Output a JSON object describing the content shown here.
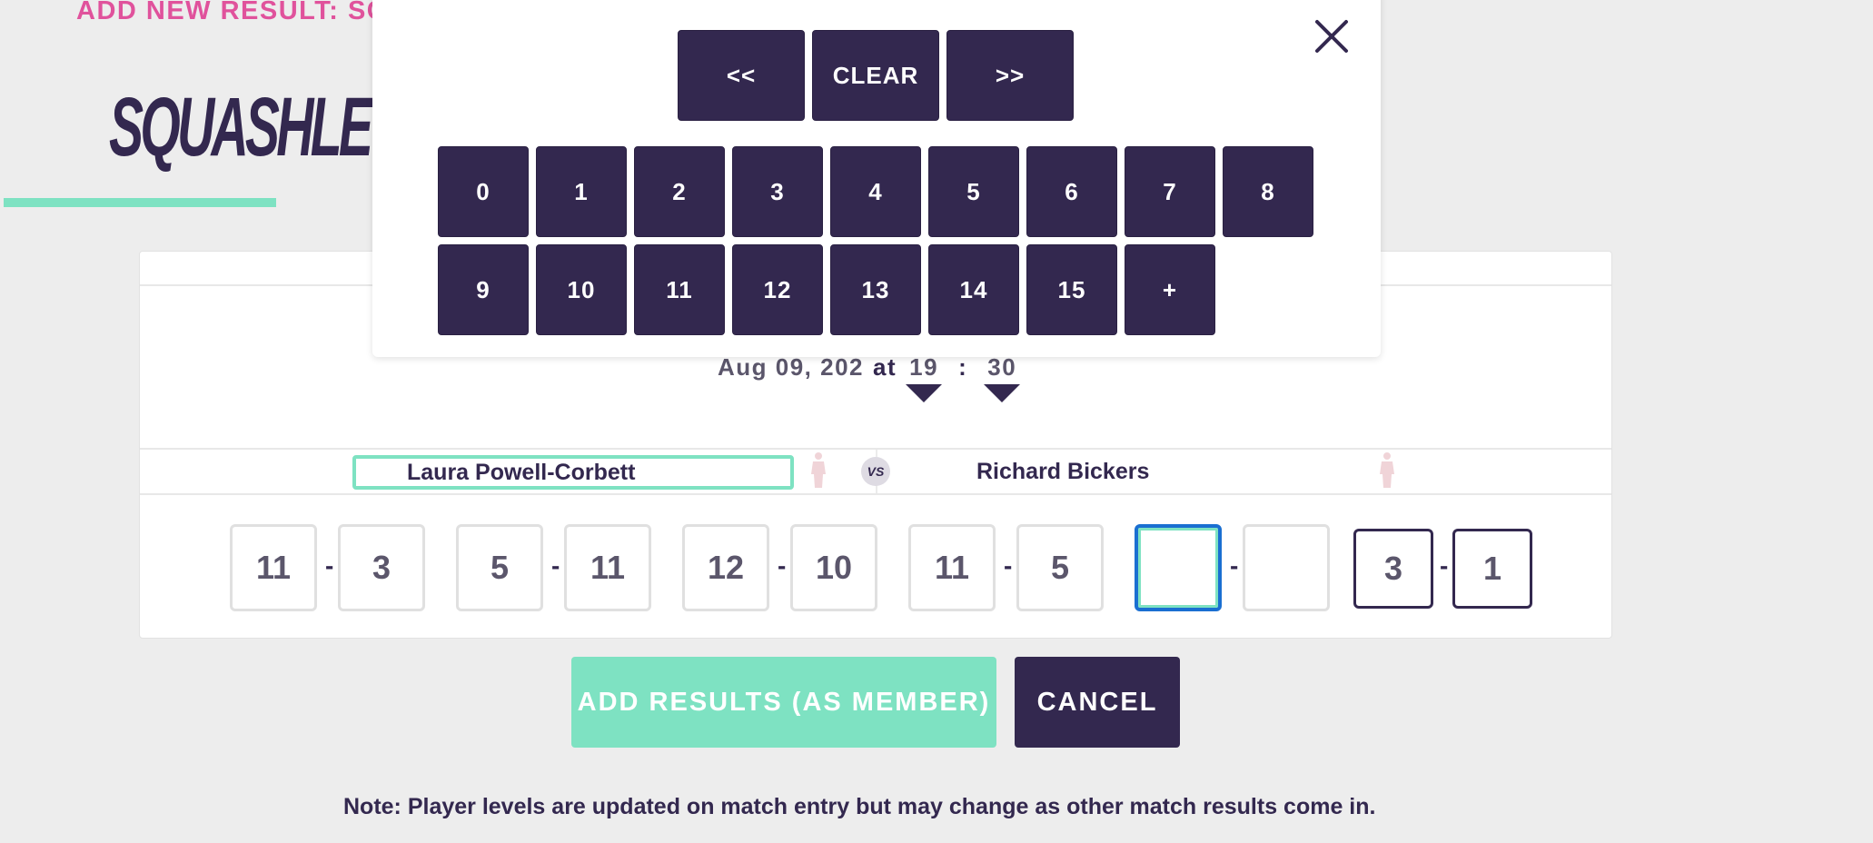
{
  "header": {
    "page_heading": "ADD NEW RESULT: SC",
    "logo_text": "SQUASHLEVEL"
  },
  "match": {
    "date": "Aug 09, 202",
    "at_label": "at",
    "hour": "19",
    "time_separator": ":",
    "minute": "30",
    "player1": "Laura Powell-Corbett",
    "vs_label": "VS",
    "player2": "Richard Bickers"
  },
  "scores": {
    "game1": {
      "p1": "11",
      "p2": "3"
    },
    "game2": {
      "p1": "5",
      "p2": "11"
    },
    "game3": {
      "p1": "12",
      "p2": "10"
    },
    "game4": {
      "p1": "11",
      "p2": "5"
    },
    "game5": {
      "p1": "",
      "p2": ""
    },
    "total": {
      "p1": "3",
      "p2": "1"
    },
    "separator": "-"
  },
  "actions": {
    "add_results_label": "ADD RESULTS (AS MEMBER)",
    "cancel_label": "CANCEL"
  },
  "note": "Note: Player levels are updated on match entry but may change as other match results come in.",
  "keypad": {
    "prev_label": "<<",
    "clear_label": "CLEAR",
    "next_label": ">>",
    "row1": [
      "0",
      "1",
      "2",
      "3",
      "4",
      "5",
      "6",
      "7",
      "8"
    ],
    "row2": [
      "9",
      "10",
      "11",
      "12",
      "13",
      "14",
      "15",
      "+"
    ],
    "close_icon": "close-icon"
  },
  "colors": {
    "brand_dark": "#33284f",
    "accent_green": "#7ee2c2",
    "heading_pink": "#e0529c",
    "focus_blue": "#1a6fd1"
  }
}
